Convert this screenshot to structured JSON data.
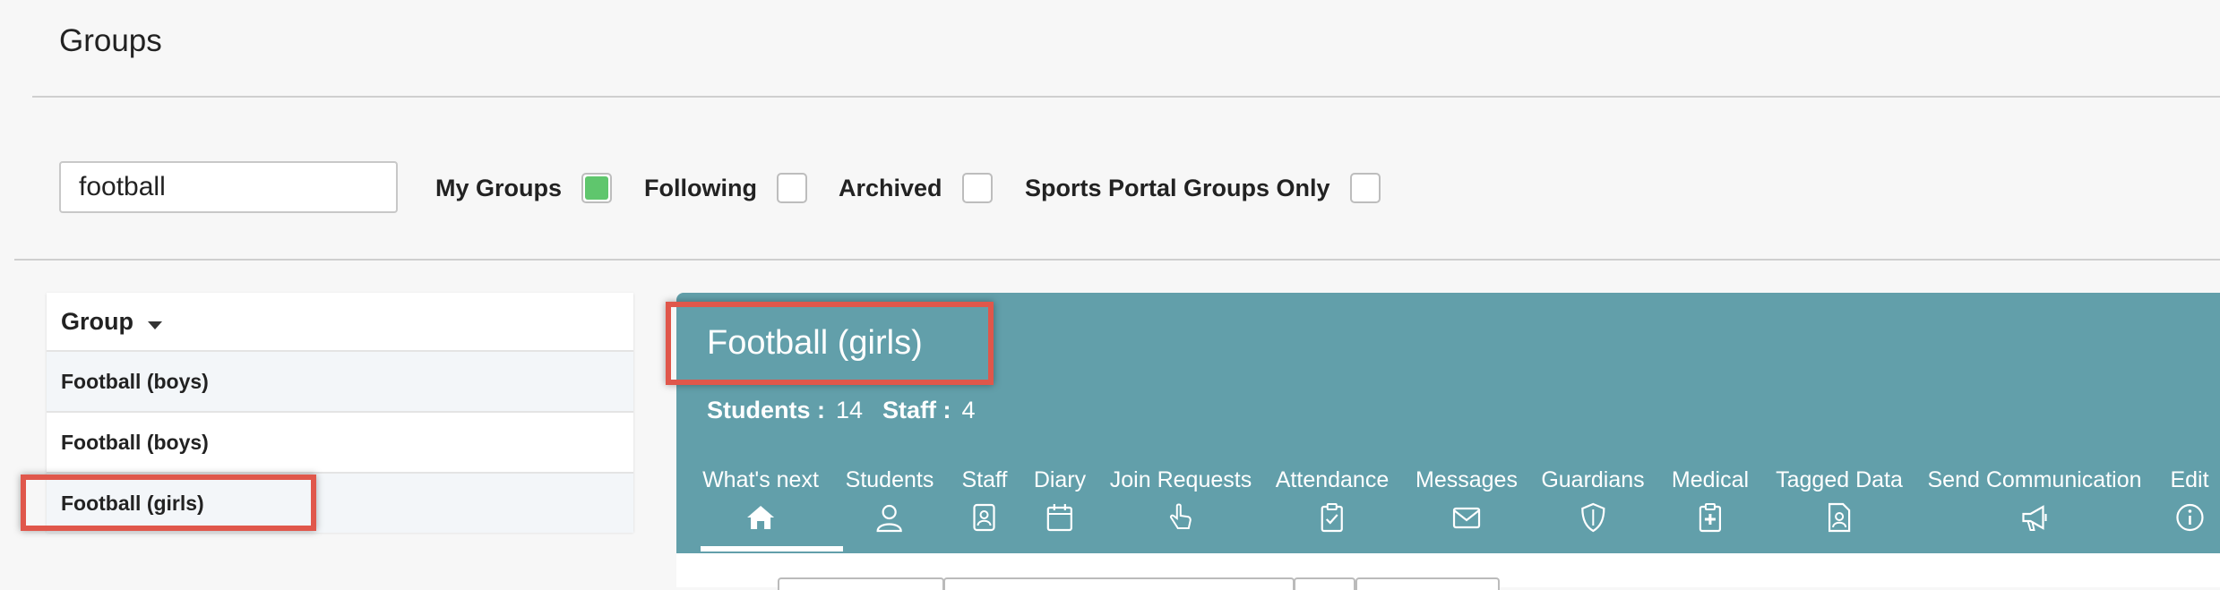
{
  "page": {
    "title": "Groups"
  },
  "search": {
    "value": "football"
  },
  "filters": [
    {
      "label": "My Groups",
      "checked": true
    },
    {
      "label": "Following",
      "checked": false
    },
    {
      "label": "Archived",
      "checked": false
    },
    {
      "label": "Sports Portal Groups Only",
      "checked": false
    }
  ],
  "group_list": {
    "header": "Group",
    "rows": [
      "Football (boys)",
      "Football (boys)",
      "Football (girls)"
    ]
  },
  "detail": {
    "title": "Football (girls)",
    "students_label": "Students :",
    "students_value": "14",
    "staff_label": "Staff :",
    "staff_value": "4",
    "tabs": [
      {
        "label": "What's next",
        "icon": "home-icon"
      },
      {
        "label": "Students",
        "icon": "person-icon"
      },
      {
        "label": "Staff",
        "icon": "staff-badge-icon"
      },
      {
        "label": "Diary",
        "icon": "calendar-icon"
      },
      {
        "label": "Join Requests",
        "icon": "hand-pointer-icon"
      },
      {
        "label": "Attendance",
        "icon": "clipboard-check-icon"
      },
      {
        "label": "Messages",
        "icon": "envelope-icon"
      },
      {
        "label": "Guardians",
        "icon": "shield-icon"
      },
      {
        "label": "Medical",
        "icon": "medical-clipboard-icon"
      },
      {
        "label": "Tagged Data",
        "icon": "tagged-document-icon"
      },
      {
        "label": "Send Communication",
        "icon": "megaphone-icon"
      },
      {
        "label": "Edit",
        "icon": "info-icon"
      }
    ]
  },
  "colors": {
    "accent": "#629faa",
    "highlight": "#e0574b",
    "checked": "#5fc66d"
  }
}
